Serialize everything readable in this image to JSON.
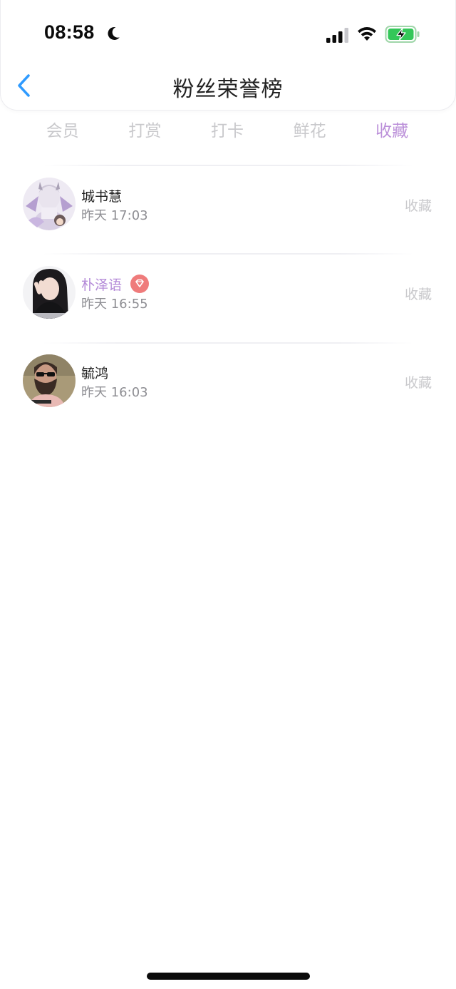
{
  "status_bar": {
    "time": "08:58",
    "focus_icon": "moon-icon",
    "signal_icon": "cellular-signal-icon",
    "wifi_icon": "wifi-icon",
    "battery_icon": "battery-charging-icon",
    "battery_color": "#34c759"
  },
  "header": {
    "back_icon": "chevron-left-icon",
    "title": "粉丝荣誉榜",
    "accent_color": "#2f9bff"
  },
  "tabs": [
    {
      "label": "会员",
      "active": false
    },
    {
      "label": "打赏",
      "active": false
    },
    {
      "label": "打卡",
      "active": false
    },
    {
      "label": "鲜花",
      "active": false
    },
    {
      "label": "收藏",
      "active": true
    }
  ],
  "tab_active_color": "#bb8fd9",
  "list": [
    {
      "name": "城书慧",
      "time": "昨天 17:03",
      "action": "收藏",
      "vip": false,
      "avatar": "avatar-anime-character"
    },
    {
      "name": "朴泽语",
      "time": "昨天 16:55",
      "action": "收藏",
      "vip": true,
      "badge_icon": "diamond-badge-icon",
      "avatar": "avatar-woman-peace-sign"
    },
    {
      "name": "毓鸿",
      "time": "昨天 16:03",
      "action": "收藏",
      "vip": false,
      "avatar": "avatar-bearded-man-sunglasses"
    }
  ]
}
